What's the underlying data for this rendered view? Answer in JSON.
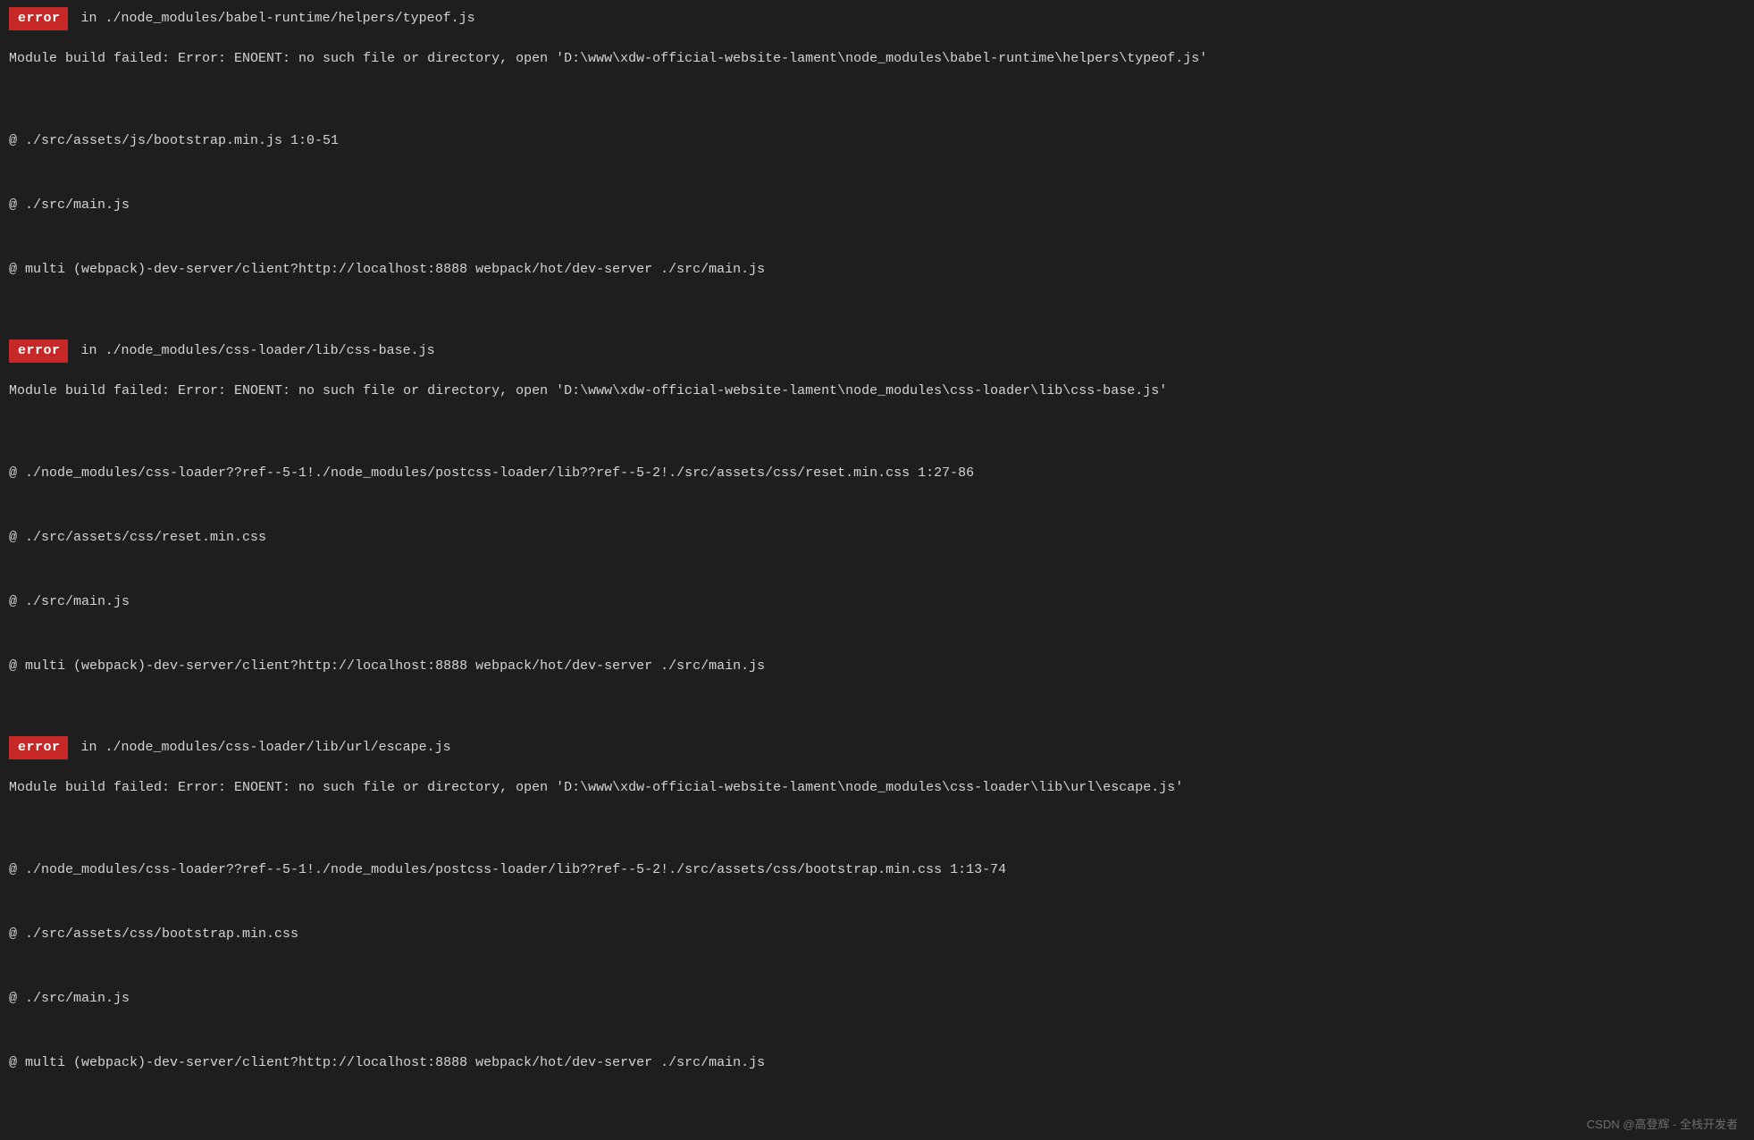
{
  "errors": [
    {
      "badge": "error",
      "location": "in ./node_modules/babel-runtime/helpers/typeof.js",
      "message": "Module build failed: Error: ENOENT: no such file or directory, open 'D:\\www\\xdw-official-website-lament\\node_modules\\babel-runtime\\helpers\\typeof.js'",
      "stack": [
        "@ ./src/assets/js/bootstrap.min.js 1:0-51",
        "@ ./src/main.js",
        "@ multi (webpack)-dev-server/client?http://localhost:8888 webpack/hot/dev-server ./src/main.js"
      ]
    },
    {
      "badge": "error",
      "location": "in ./node_modules/css-loader/lib/css-base.js",
      "message": "Module build failed: Error: ENOENT: no such file or directory, open 'D:\\www\\xdw-official-website-lament\\node_modules\\css-loader\\lib\\css-base.js'",
      "stack": [
        "@ ./node_modules/css-loader??ref--5-1!./node_modules/postcss-loader/lib??ref--5-2!./src/assets/css/reset.min.css 1:27-86",
        "@ ./src/assets/css/reset.min.css",
        "@ ./src/main.js",
        "@ multi (webpack)-dev-server/client?http://localhost:8888 webpack/hot/dev-server ./src/main.js"
      ]
    },
    {
      "badge": "error",
      "location": "in ./node_modules/css-loader/lib/url/escape.js",
      "message": "Module build failed: Error: ENOENT: no such file or directory, open 'D:\\www\\xdw-official-website-lament\\node_modules\\css-loader\\lib\\url\\escape.js'",
      "stack": [
        "@ ./node_modules/css-loader??ref--5-1!./node_modules/postcss-loader/lib??ref--5-2!./src/assets/css/bootstrap.min.css 1:13-74",
        "@ ./src/assets/css/bootstrap.min.css",
        "@ ./src/main.js",
        "@ multi (webpack)-dev-server/client?http://localhost:8888 webpack/hot/dev-server ./src/main.js"
      ]
    }
  ],
  "watermark": "CSDN @高登辉 - 全栈开发者"
}
